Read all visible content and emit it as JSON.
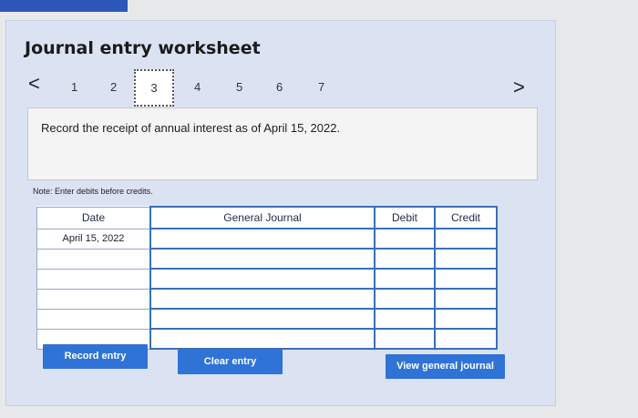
{
  "title": "Journal entry worksheet",
  "nav": {
    "prev": "<",
    "next": ">"
  },
  "steps": [
    "1",
    "2",
    "3",
    "4",
    "5",
    "6",
    "7"
  ],
  "active_step": "3",
  "prompt": "Record the receipt of annual interest as of April 15, 2022.",
  "note": "Note: Enter debits before credits.",
  "table": {
    "headers": {
      "date": "Date",
      "general_journal": "General Journal",
      "debit": "Debit",
      "credit": "Credit"
    },
    "rows": [
      {
        "date": "April 15, 2022"
      },
      {
        "date": ""
      },
      {
        "date": ""
      },
      {
        "date": ""
      },
      {
        "date": ""
      },
      {
        "date": ""
      }
    ]
  },
  "buttons": {
    "record": "Record entry",
    "clear": "Clear entry",
    "view": "View general journal"
  },
  "colors": {
    "accent": "#2f73d6",
    "panel": "#dbe2f2"
  }
}
